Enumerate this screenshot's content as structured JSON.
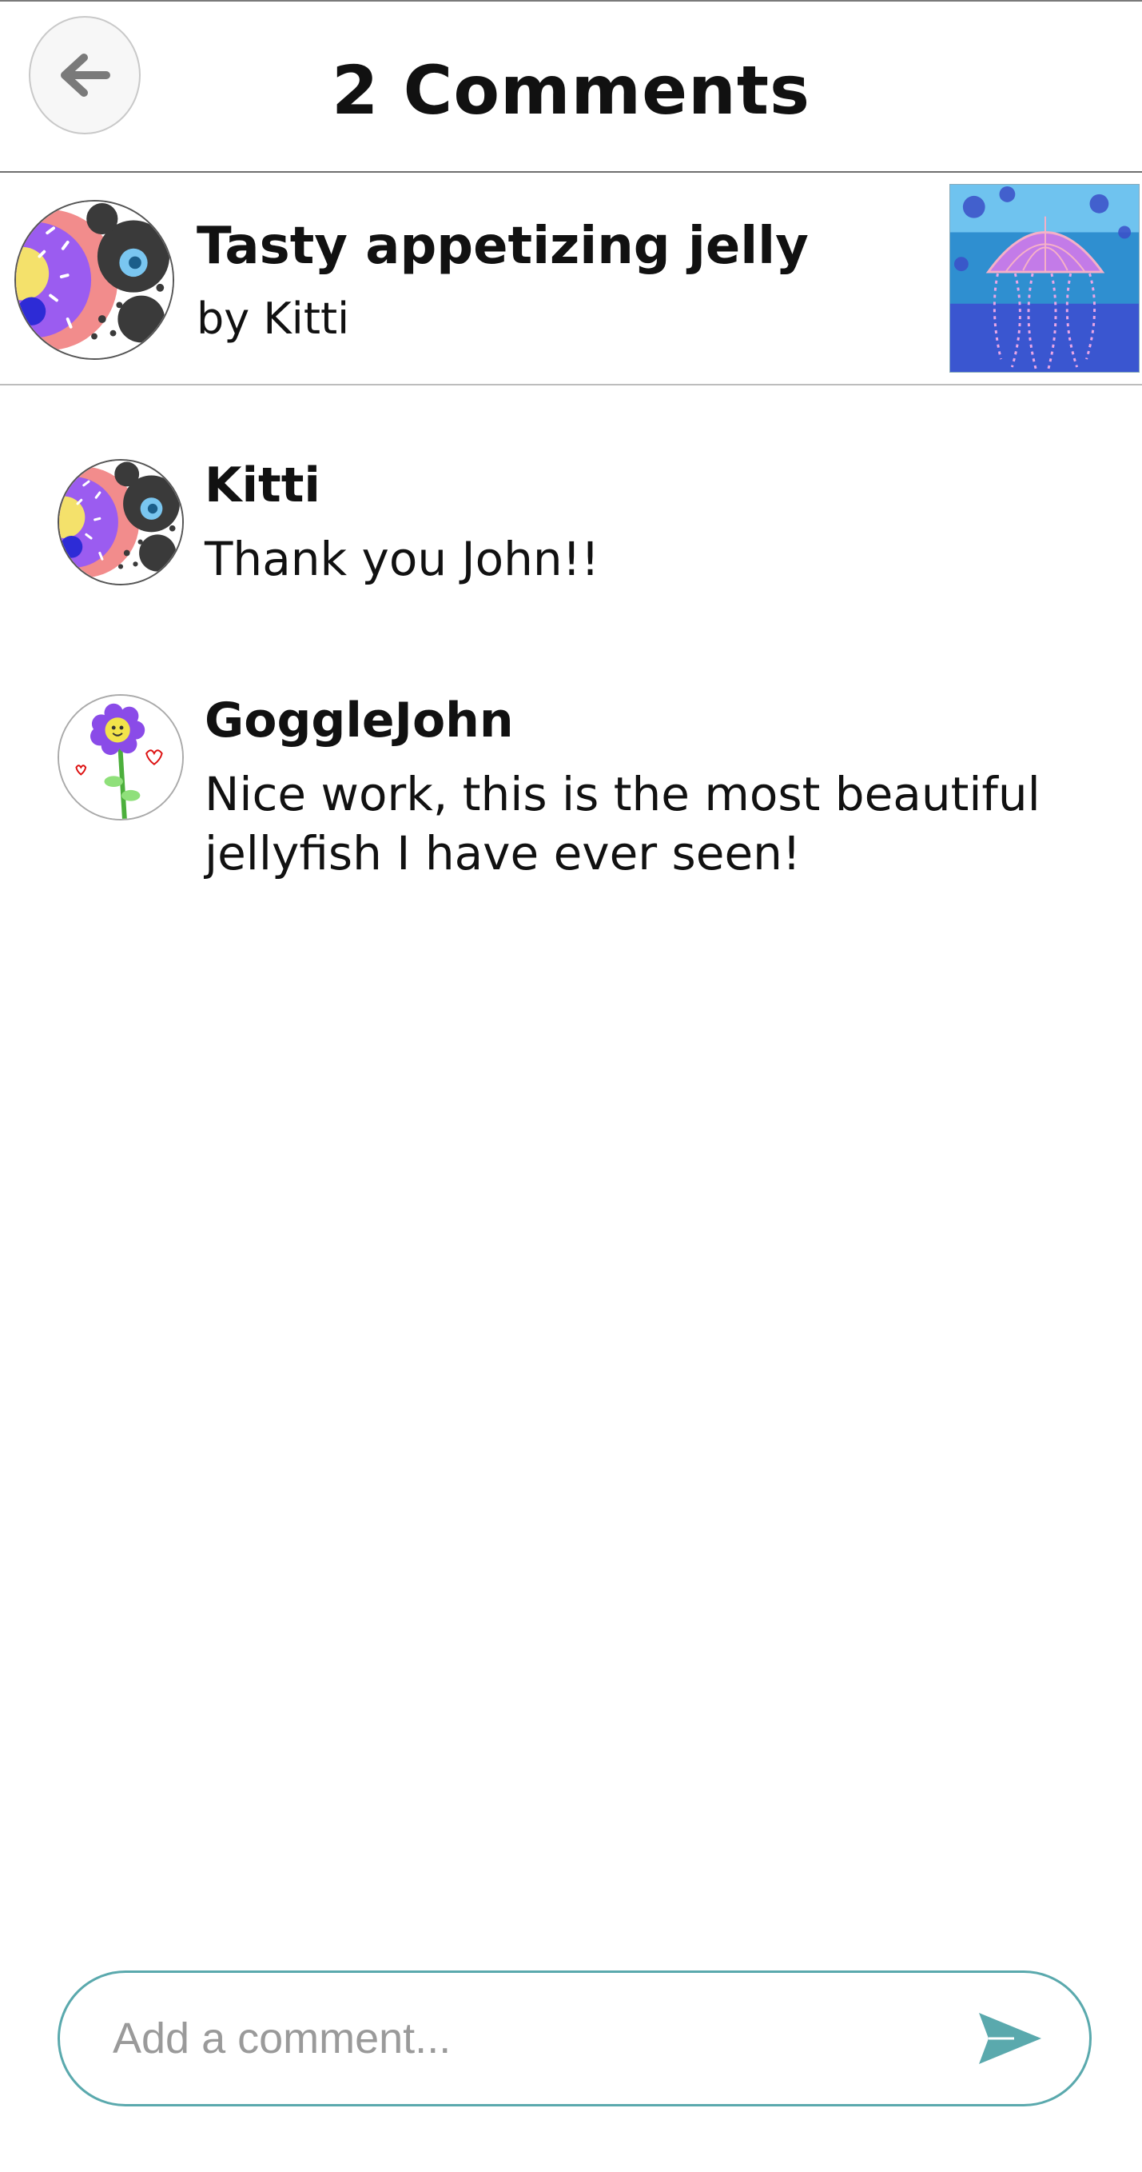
{
  "header": {
    "title": "2 Comments",
    "back_icon": "arrow-left-icon"
  },
  "artwork": {
    "title": "Tasty appetizing jelly",
    "byline": "by Kitti",
    "author_avatar": "donut-panda-avatar",
    "thumbnail": "jellyfish-artwork-thumbnail"
  },
  "comments": [
    {
      "author": "Kitti",
      "text": "Thank you John!!",
      "avatar": "donut-panda-avatar"
    },
    {
      "author": "GoggleJohn",
      "text": "Nice work, this is the most beautiful jellyfish I have ever seen!",
      "avatar": "flower-avatar"
    }
  ],
  "composer": {
    "placeholder": "Add a comment...",
    "value": "",
    "send_icon": "send-icon"
  },
  "colors": {
    "accent": "#5aa9ad",
    "text": "#111111",
    "placeholder": "#9a9a9a"
  }
}
